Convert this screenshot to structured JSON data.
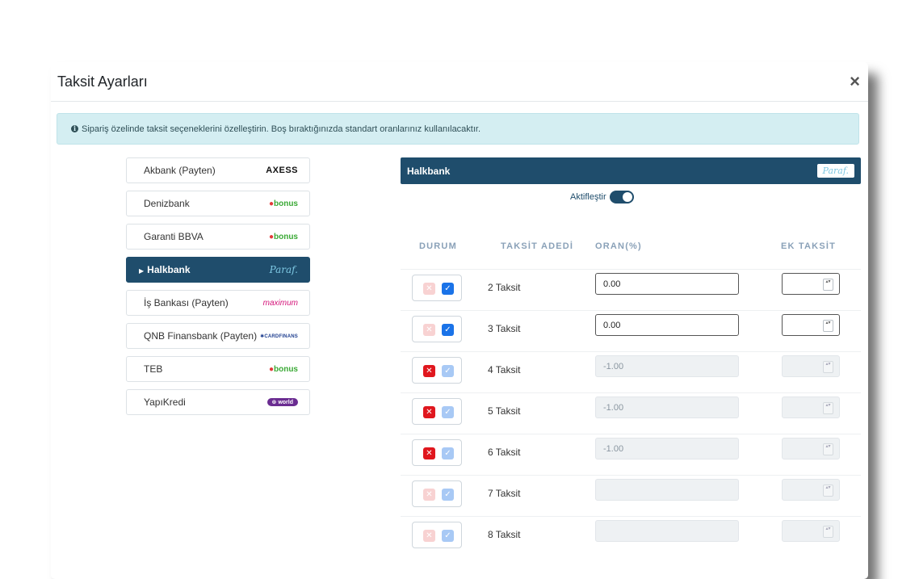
{
  "modal": {
    "title": "Taksit Ayarları",
    "close": "×",
    "info_icon": "i",
    "alert": "Sipariş özelinde taksit seçeneklerini özelleştirin. Boş bıraktığınızda standart oranlarınız kullanılacaktır."
  },
  "banks": [
    {
      "label": "Akbank (Payten)",
      "logo": "AXESS"
    },
    {
      "label": "Denizbank",
      "logo_dot": "●",
      "logo": "bonus"
    },
    {
      "label": "Garanti BBVA",
      "logo_dot": "●",
      "logo": "bonus"
    },
    {
      "label": "Halkbank",
      "logo": "Paraf."
    },
    {
      "label": "İş Bankası (Payten)",
      "logo": "maximum"
    },
    {
      "label": "QNB Finansbank (Payten)",
      "logo": "✱CARDFINANS"
    },
    {
      "label": "TEB",
      "logo_dot": "●",
      "logo": "bonus"
    },
    {
      "label": "YapıKredi",
      "logo": "⊛ world"
    }
  ],
  "selected_bank": {
    "name": "Halkbank",
    "badge": "Paraf.",
    "activate_label": "Aktifleştir",
    "active": true
  },
  "columns": {
    "status": "DURUM",
    "count": "TAKSİT ADEDİ",
    "rate": "ORAN(%)",
    "extra": "EK TAKSİT"
  },
  "symbols": {
    "x": "✕",
    "check": "✓",
    "spin": "▴▾"
  },
  "rows": [
    {
      "label": "2 Taksit",
      "rate": "0.00",
      "enabled": true
    },
    {
      "label": "3 Taksit",
      "rate": "0.00",
      "enabled": true
    },
    {
      "label": "4 Taksit",
      "rate": "-1.00",
      "enabled": false
    },
    {
      "label": "5 Taksit",
      "rate": "-1.00",
      "enabled": false
    },
    {
      "label": "6 Taksit",
      "rate": "-1.00",
      "enabled": false
    },
    {
      "label": "7 Taksit",
      "rate": "",
      "enabled": false
    },
    {
      "label": "8 Taksit",
      "rate": "",
      "enabled": false
    }
  ],
  "colors": {
    "primary": "#1f4d6c",
    "alert_bg": "#d4eef2",
    "danger": "#e0171e",
    "checkbox": "#1a73e8"
  }
}
